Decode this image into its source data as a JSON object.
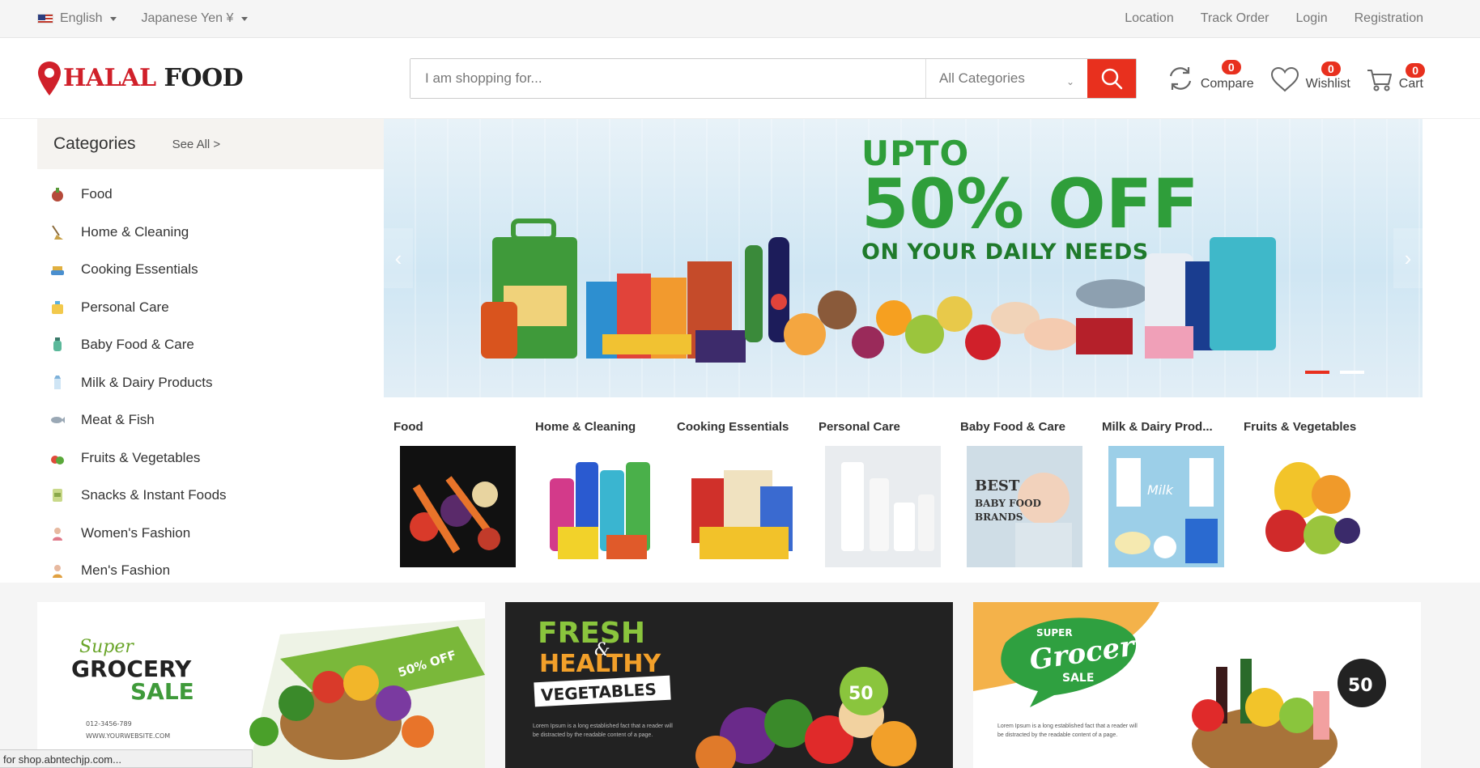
{
  "topbar": {
    "language": "English",
    "currency": "Japanese Yen ¥",
    "links": [
      "Location",
      "Track Order",
      "Login",
      "Registration"
    ]
  },
  "header": {
    "logo_halal": "HALAL",
    "logo_food": "FOOD",
    "search_placeholder": "I am shopping for...",
    "category_select": "All Categories",
    "compare_label": "Compare",
    "compare_count": "0",
    "wishlist_label": "Wishlist",
    "wishlist_count": "0",
    "cart_label": "Cart",
    "cart_count": "0"
  },
  "sidebar": {
    "title": "Categories",
    "see_all": "See All >",
    "items": [
      "Food",
      "Home & Cleaning",
      "Cooking Essentials",
      "Personal Care",
      "Baby Food & Care",
      "Milk & Dairy Products",
      "Meat & Fish",
      "Fruits & Vegetables",
      "Snacks & Instant Foods",
      "Women's Fashion",
      "Men's Fashion"
    ]
  },
  "slider": {
    "upto": "UPTO",
    "percent": "50% OFF",
    "subtitle": "ON YOUR DAILY NEEDS",
    "prev": "‹",
    "next": "›"
  },
  "featured_categories": [
    "Food",
    "Home & Cleaning",
    "Cooking Essentials",
    "Personal Care",
    "Baby Food & Care",
    "Milk & Dairy Prod...",
    "Fruits & Vegetables"
  ],
  "banners": {
    "b1_super": "Super",
    "b1_grocery": "GROCERY",
    "b1_sale": "SALE",
    "b1_phone": "012-3456-789",
    "b1_web": "WWW.YOURWEBSITE.COM",
    "b1_badge": "50% OFF",
    "b2_fresh": "FRESH",
    "b2_and": "&",
    "b2_healthy": "HEALTHY",
    "b2_veg": "VEGETABLES",
    "b2_lorem": "Lorem Ipsum is a long established fact that a reader will be distracted by the readable content of a page.",
    "b2_badge": "50",
    "b3_super": "SUPER",
    "b3_grocery": "Grocery",
    "b3_sale": "SALE",
    "b3_lorem": "Lorem Ipsum is a long established fact that a reader will be distracted by the readable content of a page.",
    "b3_badge": "50"
  },
  "status_url": "for shop.abntechjp.com...",
  "colors": {
    "accent": "#e8301e",
    "green": "#2f9e3a"
  }
}
